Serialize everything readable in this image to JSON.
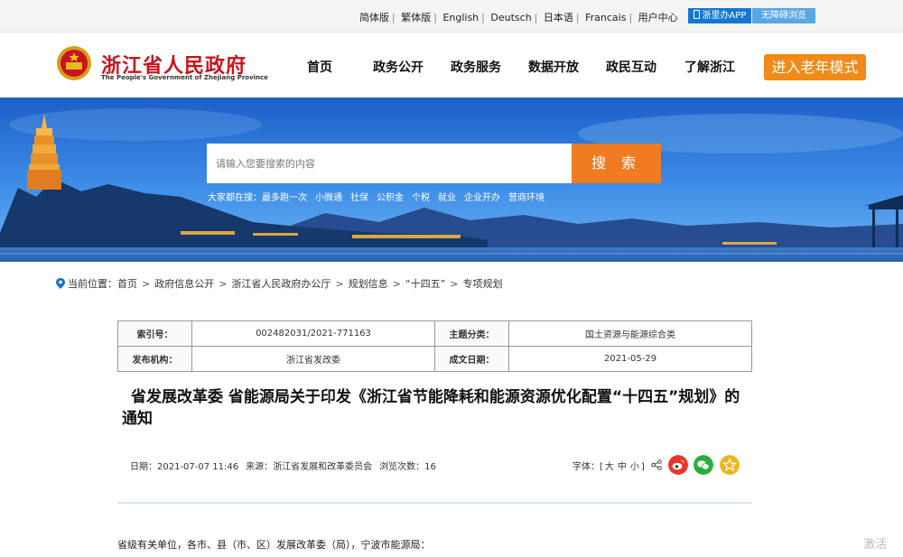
{
  "topbar": {
    "languages": [
      "简体版",
      "繁体版",
      "English",
      "Deutsch",
      "日本语",
      "Francais",
      "用户中心"
    ],
    "app_label": "浙里办APP",
    "accessible_label": "无障碍浏览"
  },
  "header": {
    "title": "浙江省人民政府",
    "subtitle": "The People's Government of Zhejiang Province",
    "nav": [
      "首页",
      "政务公开",
      "政务服务",
      "数据开放",
      "政民互动",
      "了解浙江"
    ],
    "elder_mode": "进入老年模式"
  },
  "search": {
    "placeholder": "请输入您要搜索的内容",
    "button": "搜 索",
    "hot_label": "大家都在搜：",
    "hot_keywords": [
      "最多跑一次",
      "小微通",
      "社保",
      "公积金",
      "个税",
      "就业",
      "企业开办",
      "营商环境"
    ]
  },
  "breadcrumb": {
    "label": "当前位置：",
    "items": [
      "首页",
      "政府信息公开",
      "浙江省人民政府办公厅",
      "规划信息",
      "“十四五”",
      "专项规划"
    ]
  },
  "meta": {
    "index_label": "索引号：",
    "index_value": "002482031/2021-771163",
    "category_label": "主题分类：",
    "category_value": "国土资源与能源综合类",
    "publisher_label": "发布机构：",
    "publisher_value": "浙江省发改委",
    "date_label": "成文日期：",
    "date_value": "2021-05-29"
  },
  "article": {
    "title": "省发展改革委 省能源局关于印发《浙江省节能降耗和能源资源优化配置“十四五”规划》的通知",
    "date": "日期：2021-07-07 11:46",
    "source": "来源：浙江省发展和改革委员会",
    "views": "浏览次数：16",
    "font_label": "字体：[",
    "font_sizes": [
      "大",
      "中",
      "小"
    ],
    "font_close": "]",
    "body_first_line": "省级有关单位，各市、县（市、区）发展改革委（局），宁波市能源局："
  },
  "watermark": "激活",
  "colors": {
    "brand_red": "#c9141c",
    "accent_orange": "#f07b22",
    "app_blue": "#1677d2",
    "weibo_red": "#e6372f",
    "wechat_green": "#2bad38",
    "favorite_yellow": "#f0b51c"
  }
}
